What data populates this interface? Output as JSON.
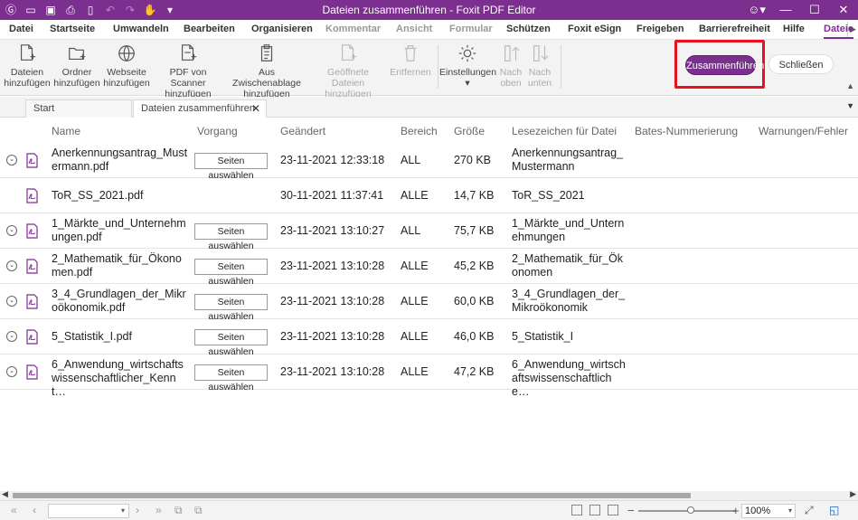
{
  "window": {
    "title": "Dateien zusammenführen - Foxit PDF Editor",
    "quick_access_icons": [
      "foxit-logo-icon",
      "open-folder-icon",
      "save-icon",
      "print-icon",
      "new-document-icon",
      "undo-icon",
      "redo-icon",
      "hand-tool-icon",
      "customize-arrow-icon"
    ],
    "controls": [
      "user-icon",
      "minimize-icon",
      "maximize-icon",
      "close-icon"
    ]
  },
  "menu": {
    "tabs": [
      {
        "label": "Datei",
        "state": "normal"
      },
      {
        "label": "Startseite",
        "state": "normal"
      },
      {
        "label": "Umwandeln",
        "state": "normal"
      },
      {
        "label": "Bearbeiten",
        "state": "normal"
      },
      {
        "label": "Organisieren",
        "state": "normal"
      },
      {
        "label": "Kommentar",
        "state": "dim"
      },
      {
        "label": "Ansicht",
        "state": "dim"
      },
      {
        "label": "Formular",
        "state": "dim"
      },
      {
        "label": "Schützen",
        "state": "normal"
      },
      {
        "label": "Foxit eSign",
        "state": "normal"
      },
      {
        "label": "Freigeben",
        "state": "normal"
      },
      {
        "label": "Barrierefreiheit",
        "state": "normal"
      },
      {
        "label": "Hilfe",
        "state": "normal"
      },
      {
        "label": "Dateie",
        "state": "active"
      }
    ]
  },
  "ribbon": {
    "buttons": [
      {
        "label1": "Dateien",
        "label2": "hinzufügen",
        "icon": "add-files-icon",
        "enabled": true
      },
      {
        "label1": "Ordner",
        "label2": "hinzufügen",
        "icon": "add-folder-icon",
        "enabled": true
      },
      {
        "label1": "Webseite",
        "label2": "hinzufügen",
        "icon": "globe-icon",
        "enabled": true
      },
      {
        "label1": "PDF von Scanner",
        "label2": "hinzufügen",
        "icon": "scanner-icon",
        "enabled": true
      },
      {
        "label1": "Aus Zwischenablage",
        "label2": "hinzufügen",
        "icon": "clipboard-icon",
        "enabled": true
      },
      {
        "label1": "Geöffnete Dateien",
        "label2": "hinzufügen",
        "icon": "open-files-icon",
        "enabled": false
      },
      {
        "label1": "Entfernen",
        "label2": "",
        "icon": "trash-icon",
        "enabled": false
      },
      {
        "label1": "Einstellungen",
        "label2": "▾",
        "icon": "settings-gear-icon",
        "enabled": true
      },
      {
        "label1": "Nach",
        "label2": "oben",
        "icon": "move-up-icon",
        "enabled": false
      },
      {
        "label1": "Nach",
        "label2": "unten",
        "icon": "move-down-icon",
        "enabled": false
      }
    ],
    "merge_label": "Zusammenführen",
    "close_label": "Schließen"
  },
  "doc_tabs": {
    "start_label": "Start",
    "active_label": "Dateien zusammenführen",
    "close_glyph": "✕"
  },
  "table": {
    "headers": [
      "Name",
      "Vorgang",
      "Geändert",
      "Bereich",
      "Größe",
      "Lesezeichen für Datei",
      "Bates-Nummerierung",
      "Warnungen/Fehler"
    ],
    "select_label": "Seiten auswählen",
    "rows": [
      {
        "name": "Anerkennungsantrag_Mustermann.pdf",
        "expandable": true,
        "has_select": true,
        "date": "23-11-2021 12:33:18",
        "range": "ALL",
        "size": "270 KB",
        "bookmark": "Anerkennungsantrag_Mustermann"
      },
      {
        "name": "ToR_SS_2021.pdf",
        "expandable": false,
        "has_select": false,
        "date": "30-11-2021 11:37:41",
        "range": "ALLE",
        "size": "14,7 KB",
        "bookmark": "ToR_SS_2021"
      },
      {
        "name": "1_Märkte_und_Unternehmungen.pdf",
        "expandable": true,
        "has_select": true,
        "date": "23-11-2021 13:10:27",
        "range": "ALL",
        "size": "75,7 KB",
        "bookmark": "1_Märkte_und_Unternehmungen"
      },
      {
        "name": "2_Mathematik_für_Ökonomen.pdf",
        "expandable": true,
        "has_select": true,
        "date": "23-11-2021 13:10:28",
        "range": "ALLE",
        "size": "45,2 KB",
        "bookmark": "2_Mathematik_für_Ökonomen"
      },
      {
        "name": "3_4_Grundlagen_der_Mikroökonomik.pdf",
        "expandable": true,
        "has_select": true,
        "date": "23-11-2021 13:10:28",
        "range": "ALLE",
        "size": "60,0 KB",
        "bookmark": "3_4_Grundlagen_der_Mikroökonomik"
      },
      {
        "name": "5_Statistik_I.pdf",
        "expandable": true,
        "has_select": true,
        "date": "23-11-2021 13:10:28",
        "range": "ALLE",
        "size": "46,0 KB",
        "bookmark": "5_Statistik_I"
      },
      {
        "name": "6_Anwendung_wirtschaftswissenschaftlicher_Kennt…",
        "expandable": true,
        "has_select": true,
        "date": "23-11-2021 13:10:28",
        "range": "ALLE",
        "size": "47,2 KB",
        "bookmark": "6_Anwendung_wirtschaftswissenschaftliche…"
      }
    ]
  },
  "status": {
    "zoom": "100%",
    "zoom_fraction": 0.54
  },
  "colors": {
    "accent": "#7b2f8e",
    "highlight": "#e81123"
  }
}
